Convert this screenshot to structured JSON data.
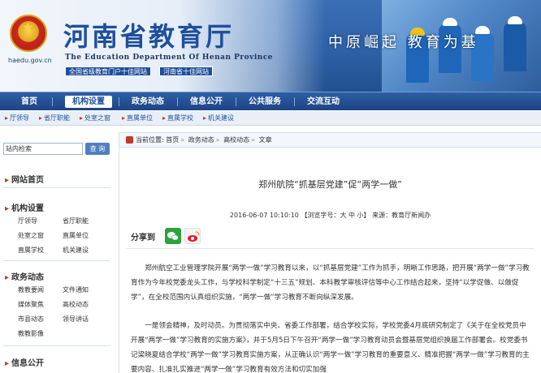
{
  "header": {
    "title": "河南省教育厅",
    "subtitle": "The Education Department Of Henan Province",
    "url": "haedu.gov.cn",
    "awards": [
      "全国省级教育门户十佳网站",
      "河南省十佳网站"
    ],
    "slogan": "中原崛起 教育为基"
  },
  "nav": {
    "items": [
      "首页",
      "机构设置",
      "政务动态",
      "信息公开",
      "公共服务",
      "交流互动"
    ],
    "active": "机构设置"
  },
  "subnav": {
    "items": [
      "厅领导",
      "省厅职能",
      "处室之窗",
      "直属单位",
      "直属学校",
      "机关建设"
    ]
  },
  "sidebar": {
    "search_value": "站内检索",
    "search_button": "查 询",
    "sections": [
      {
        "title": "网站首页",
        "links": []
      },
      {
        "title": "机构设置",
        "links": [
          "厅领导",
          "省厅职能",
          "处室之窗",
          "直属单位",
          "直属学校",
          "机关建设"
        ]
      },
      {
        "title": "政务动态",
        "links": [
          "教教要闻",
          "文件通知",
          "媒体聚焦",
          "高校动态",
          "市县动态",
          "领导讲话",
          "教教影像"
        ]
      },
      {
        "title": "信息公开",
        "links": []
      }
    ]
  },
  "breadcrumb": {
    "label": "当前位置:",
    "items": [
      "首页",
      "政务动态",
      "高校动态",
      "文章"
    ]
  },
  "article": {
    "title": "郑州航院“抓基层党建”促“两学一做”",
    "date": "2016-06-07 10:10:10",
    "font_label": "【浏览字号：",
    "font_sizes": [
      "大",
      "中",
      "小"
    ],
    "font_end": "】",
    "source": "来源：教育厅新闻办",
    "share_label": "分享到",
    "paragraphs": [
      "郑州航空工业管理学院开展“两学一做”学习教育以来，以“抓基层党建”工作为抓手，明晰工作思路，把开展“两学一做”学习教育作为今年校党委龙头工作，与学校科学制定“十三五”规划、本科教学审核评估等中心工作结合起来，坚持“以学促做、以做促学”，在全校范围内认真组织实施，“两学一做”学习教育不断向纵深发展。",
      "一是领会精神，及时动员。为贯彻落实中央、省委工作部署，结合学校实际，学校党委4月底研究制定了《关于在全校党员中开展“两学一做”学习教育的实施方案》，并于5月5日下午召开“两学一做”学习教育动员会暨基层党组织换届工作部署会。校党委书记梁晓夏结合学校“两学一做”学习教育实施方案，从正确认识“两学一做”学习教育的重要意义、精准把握“两学一做”学习教育的主要内容、扎准扎实推进“两学一做”学习教育有效方法和切实加强"
    ]
  }
}
